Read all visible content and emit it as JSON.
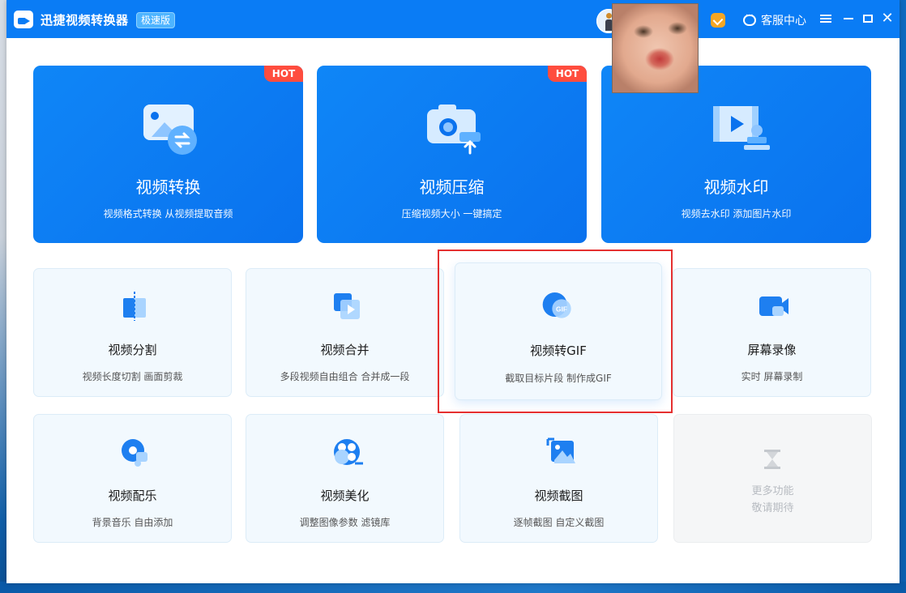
{
  "app": {
    "title": "迅捷视频转换器",
    "edition": "极速版",
    "service_label": "客服中心"
  },
  "colors": {
    "accent": "#0a7cf5",
    "hot": "#ff4d3e",
    "highlight": "#e53030"
  },
  "big_cards": [
    {
      "title": "视频转换",
      "desc": "视频格式转换 从视频提取音频",
      "hot": "HOT",
      "icon": "video-convert-icon"
    },
    {
      "title": "视频压缩",
      "desc": "压缩视频大小 一键搞定",
      "hot": "HOT",
      "icon": "video-compress-icon"
    },
    {
      "title": "视频水印",
      "desc": "视频去水印 添加图片水印",
      "hot": "",
      "icon": "video-watermark-icon"
    }
  ],
  "cards": [
    {
      "title": "视频分割",
      "desc": "视频长度切割 画面剪裁",
      "icon": "video-split-icon"
    },
    {
      "title": "视频合并",
      "desc": "多段视频自由组合 合并成一段",
      "icon": "video-merge-icon"
    },
    {
      "title": "视频转GIF",
      "desc": "截取目标片段 制作成GIF",
      "icon": "video-gif-icon",
      "icon_text": "GIF"
    },
    {
      "title": "屏幕录像",
      "desc": "实时 屏幕录制",
      "icon": "screen-record-icon"
    },
    {
      "title": "视频配乐",
      "desc": "背景音乐 自由添加",
      "icon": "video-music-icon"
    },
    {
      "title": "视频美化",
      "desc": "调整图像参数 滤镜库",
      "icon": "video-beautify-icon"
    },
    {
      "title": "视频截图",
      "desc": "逐帧截图 自定义截图",
      "icon": "video-screenshot-icon"
    }
  ],
  "more": {
    "line1": "更多功能",
    "line2": "敬请期待",
    "icon": "hourglass-icon"
  }
}
